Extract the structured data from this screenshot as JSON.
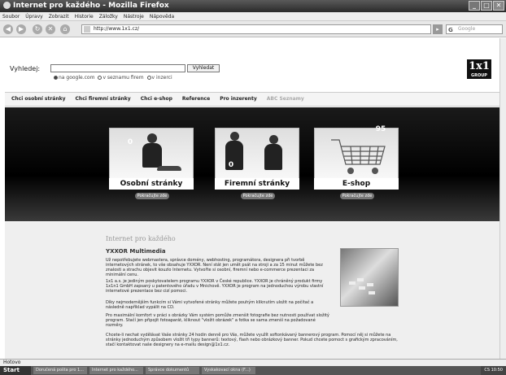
{
  "window": {
    "title": "Internet pro každého - Mozilla Firefox"
  },
  "menubar": [
    "Soubor",
    "Úpravy",
    "Zobrazit",
    "Historie",
    "Záložky",
    "Nástroje",
    "Nápověda"
  ],
  "navbar": {
    "url": "http://www.1x1.cz/",
    "search_placeholder": "Google"
  },
  "search": {
    "label": "Vyhledej:",
    "value": "",
    "button": "Vyhledat",
    "options": [
      "na google.com",
      "v seznamu firem",
      "v inzerci"
    ]
  },
  "logo": {
    "text": "1x1",
    "sub": "GROUP"
  },
  "tabs": [
    "Chci osobní stránky",
    "Chci firemní stránky",
    "Chci e-shop",
    "Reference",
    "Pro inzerenty",
    "ABC Seznamy"
  ],
  "cards": [
    {
      "label": "Osobní stránky",
      "badge": "0",
      "button": "Pokračujte zde"
    },
    {
      "label": "Firemní stránky",
      "badge": "0",
      "button": "Pokračujte zde"
    },
    {
      "label": "E-shop",
      "badge": "95",
      "button": "Pokračujte zde"
    }
  ],
  "content": {
    "title": "Internet pro každého",
    "heading": "YXXOR Multimedia",
    "p1": "Už nepotřebujete webmastera, správce domény, webhosting, programátora, designera při tvorbě internetových stránek, to vše obsahuje YXXOR. Není stát jen umět psát na stroji a za 15 minut můžete bez znalosti a strachu objevit kouzlo Internetu. Vytvořte si osobní, firemní nebo e-commerce prezentaci za minimální cenu.",
    "p2": "1x1 a.s. je jediným poskytovatelem programu YXXOR v České republice. YXXOR je chráněný produkt firmy 1x1n1 GmbH zapsaný u patentového úřadu v Mnichově. YXXOR je program na jednoduchou výrobu vlastní internetové prezentace bez cizí pomoci.",
    "p3": "Díky nejmodernějším funkcím si Vámi vytvořené stránky můžete pouhým kliknutím uložit na počítač a následně například vypálit na CD.",
    "p4": "Pro maximální komfort v práci s obrázky Vám systém pomůže zmenšit fotografie bez nutnosti používat složitý program. Stačí jen připojit fotoaparát, kliknout \"vložit obrázek\" a fotka se sama zmenší na požadované rozměry.",
    "p5": "Chcete-li nechat vydělávat Vaše stránky 24 hodin denně pro Vás, můžete využít softonkávaný bannerový program. Pomocí něj si můžete na stránky jednoduchým způsobem vložit tři typy bannerů: textový, flash nebo obrázkový banner. Pokud chcete pomoct s grafickým zpracováním, stačí kontaktovat naše designery na e-mailu design@1x1.cz."
  },
  "status": "Hotovo",
  "taskbar": {
    "start": "Start",
    "tasks": [
      "Doručená pošta pro 1...",
      "Internet pro každého...",
      "Správce dokumentů",
      "Vyskakovací okna (F...)"
    ],
    "tray": "CS  10:50"
  }
}
